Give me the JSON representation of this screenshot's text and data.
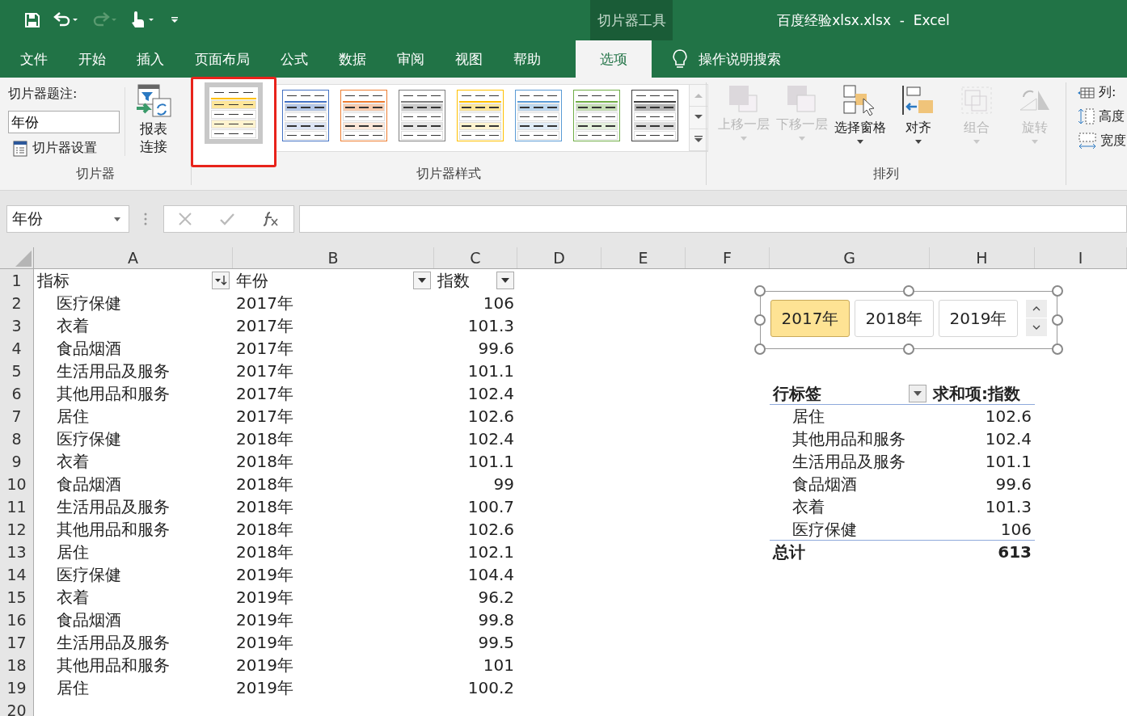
{
  "window": {
    "title": "百度经验xlsx.xlsx  -  Excel",
    "context_group": "切片器工具"
  },
  "tabs": [
    {
      "label": "文件",
      "selected": false
    },
    {
      "label": "开始",
      "selected": false
    },
    {
      "label": "插入",
      "selected": false
    },
    {
      "label": "页面布局",
      "selected": false
    },
    {
      "label": "公式",
      "selected": false
    },
    {
      "label": "数据",
      "selected": false
    },
    {
      "label": "审阅",
      "selected": false
    },
    {
      "label": "视图",
      "selected": false
    },
    {
      "label": "帮助",
      "selected": false
    },
    {
      "label": "选项",
      "selected": true
    }
  ],
  "search_hint": "操作说明搜索",
  "ribbon": {
    "slicer_group": {
      "caption_label": "切片器题注:",
      "caption_value": "年份",
      "settings": "切片器设置",
      "report_connections": [
        "报表",
        "连接"
      ],
      "label": "切片器"
    },
    "styles_group": {
      "label": "切片器样式",
      "styles": [
        {
          "color": "#ffc000",
          "selected": true
        },
        {
          "color": "#4472c4",
          "selected": false
        },
        {
          "color": "#ed7d31",
          "selected": false
        },
        {
          "color": "#7f7f7f",
          "selected": false
        },
        {
          "color": "#ffc000",
          "selected": false
        },
        {
          "color": "#5b9bd5",
          "selected": false
        },
        {
          "color": "#70ad47",
          "selected": false
        },
        {
          "color": "#404040",
          "selected": false
        }
      ]
    },
    "arrange_group": {
      "label": "排列",
      "buttons": [
        {
          "kind": "forward",
          "label": "上移一层",
          "disabled": true
        },
        {
          "kind": "backward",
          "label": "下移一层",
          "disabled": true
        },
        {
          "kind": "pane",
          "label": "选择窗格",
          "disabled": false
        },
        {
          "kind": "align",
          "label": "对齐",
          "disabled": false
        },
        {
          "kind": "group",
          "label": "组合",
          "disabled": true
        },
        {
          "kind": "rotate",
          "label": "旋转",
          "disabled": true
        }
      ]
    },
    "size_group": {
      "items": [
        {
          "kind": "columns",
          "label": "列:"
        },
        {
          "kind": "height",
          "label": "高度"
        },
        {
          "kind": "width",
          "label": "宽度"
        }
      ]
    }
  },
  "name_box": "年份",
  "sheet": {
    "columns": [
      "A",
      "B",
      "C",
      "D",
      "E",
      "F",
      "G",
      "H",
      "I"
    ],
    "header": [
      {
        "text": "指标",
        "sorted": true
      },
      {
        "text": "年份",
        "sorted": false
      },
      {
        "text": "指数",
        "sorted": false
      }
    ],
    "rows": [
      {
        "n": "2",
        "cells": [
          "医疗保健",
          "2017年",
          "106"
        ]
      },
      {
        "n": "3",
        "cells": [
          "衣着",
          "2017年",
          "101.3"
        ]
      },
      {
        "n": "4",
        "cells": [
          "食品烟酒",
          "2017年",
          "99.6"
        ]
      },
      {
        "n": "5",
        "cells": [
          "生活用品及服务",
          "2017年",
          "101.1"
        ]
      },
      {
        "n": "6",
        "cells": [
          "其他用品和服务",
          "2017年",
          "102.4"
        ]
      },
      {
        "n": "7",
        "cells": [
          "居住",
          "2017年",
          "102.6"
        ]
      },
      {
        "n": "8",
        "cells": [
          "医疗保健",
          "2018年",
          "102.4"
        ]
      },
      {
        "n": "9",
        "cells": [
          "衣着",
          "2018年",
          "101.1"
        ]
      },
      {
        "n": "10",
        "cells": [
          "食品烟酒",
          "2018年",
          "99"
        ]
      },
      {
        "n": "11",
        "cells": [
          "生活用品及服务",
          "2018年",
          "100.7"
        ]
      },
      {
        "n": "12",
        "cells": [
          "其他用品和服务",
          "2018年",
          "102.6"
        ]
      },
      {
        "n": "13",
        "cells": [
          "居住",
          "2018年",
          "102.1"
        ]
      },
      {
        "n": "14",
        "cells": [
          "医疗保健",
          "2019年",
          "104.4"
        ]
      },
      {
        "n": "15",
        "cells": [
          "衣着",
          "2019年",
          "96.2"
        ]
      },
      {
        "n": "16",
        "cells": [
          "食品烟酒",
          "2019年",
          "99.8"
        ]
      },
      {
        "n": "17",
        "cells": [
          "生活用品及服务",
          "2019年",
          "99.5"
        ]
      },
      {
        "n": "18",
        "cells": [
          "其他用品和服务",
          "2019年",
          "101"
        ]
      },
      {
        "n": "19",
        "cells": [
          "居住",
          "2019年",
          "100.2"
        ]
      },
      {
        "n": "20",
        "cells": []
      }
    ],
    "header_row_number": "1"
  },
  "slicer": {
    "items": [
      {
        "label": "2017年",
        "selected": true
      },
      {
        "label": "2018年",
        "selected": false
      },
      {
        "label": "2019年",
        "selected": false
      }
    ]
  },
  "pivot": {
    "row_label": "行标签",
    "value_label": "求和项:指数",
    "items": [
      {
        "label": "居住",
        "value": "102.6"
      },
      {
        "label": "其他用品和服务",
        "value": "102.4"
      },
      {
        "label": "生活用品及服务",
        "value": "101.1"
      },
      {
        "label": "食品烟酒",
        "value": "99.6"
      },
      {
        "label": "衣着",
        "value": "101.3"
      },
      {
        "label": "医疗保健",
        "value": "106"
      }
    ],
    "total_label": "总计",
    "total_value": "613"
  }
}
